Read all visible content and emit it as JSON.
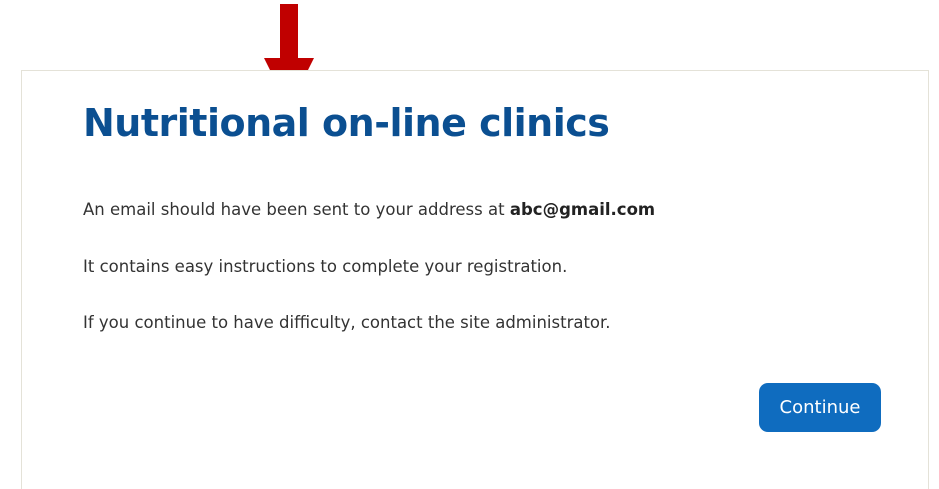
{
  "page": {
    "title": "Nutritional on-line clinics"
  },
  "message": {
    "line1_prefix": "An email should have been sent to your address at",
    "email": "abc@gmail.com",
    "line2": "It contains easy instructions to complete your registration.",
    "line3": "If you continue to have difficulty, contact the site administrator."
  },
  "actions": {
    "continue_label": "Continue"
  },
  "colors": {
    "title": "#0b4f91",
    "button": "#0f6cbf",
    "arrow": "#c00000",
    "text": "#333333"
  },
  "icons": {
    "annotation": "down-arrow-icon"
  }
}
